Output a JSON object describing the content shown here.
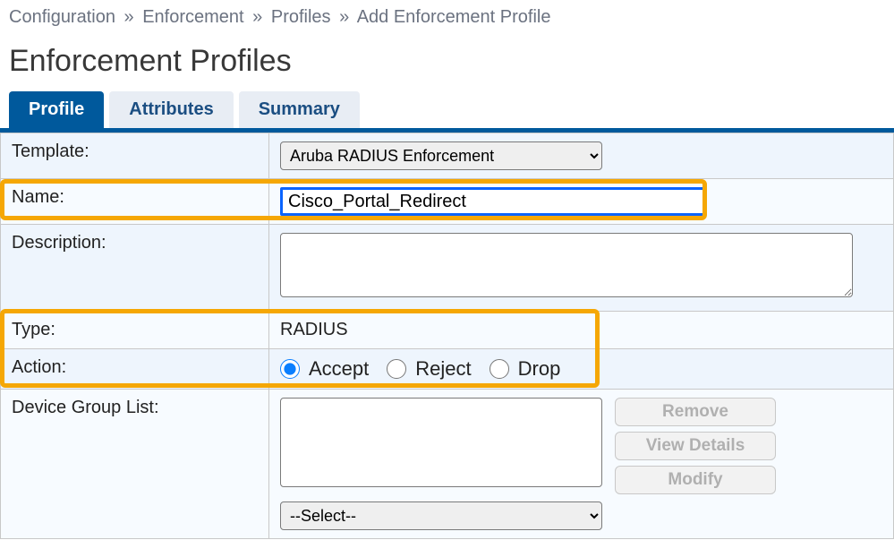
{
  "breadcrumb": {
    "items": [
      "Configuration",
      "Enforcement",
      "Profiles",
      "Add Enforcement Profile"
    ]
  },
  "page_title": "Enforcement Profiles",
  "tabs": {
    "profile": "Profile",
    "attributes": "Attributes",
    "summary": "Summary"
  },
  "labels": {
    "template": "Template:",
    "name": "Name:",
    "description": "Description:",
    "type": "Type:",
    "action": "Action:",
    "device_group_list": "Device Group List:"
  },
  "form": {
    "template_value": "Aruba RADIUS Enforcement",
    "name_value": "Cisco_Portal_Redirect",
    "description_value": "",
    "type_value": "RADIUS",
    "action_options": {
      "accept": "Accept",
      "reject": "Reject",
      "drop": "Drop"
    },
    "action_selected": "accept",
    "dgl_select_placeholder": "--Select--"
  },
  "buttons": {
    "remove": "Remove",
    "view_details": "View Details",
    "modify": "Modify"
  }
}
